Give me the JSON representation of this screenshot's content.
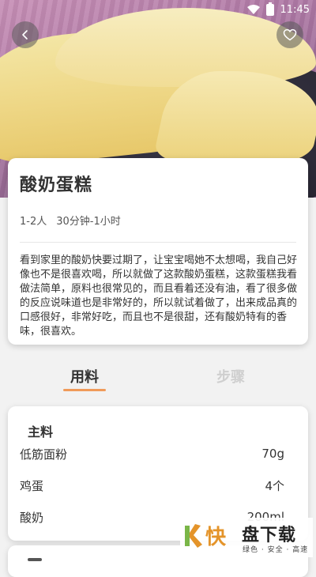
{
  "status_bar": {
    "time": "11:45",
    "wifi_icon": "wifi-icon",
    "battery_icon": "battery-icon"
  },
  "header": {
    "back_icon": "chevron-left-icon",
    "favorite_icon": "heart-icon"
  },
  "recipe": {
    "title": "酸奶蛋糕",
    "servings": "1-2人",
    "duration": "30分钟-1小时",
    "description": "看到家里的酸奶快要过期了，让宝宝喝她不太想喝，我自己好像也不是很喜欢喝，所以就做了这款酸奶蛋糕，这款蛋糕我看做法简单，原料也很常见的，而且看着还没有油，看了很多做的反应说味道也是非常好的，所以就试着做了，出来成品真的口感很好，非常好吃，而且也不是很甜，还有酸奶特有的香味，很喜欢。"
  },
  "tabs": [
    {
      "label": "用料",
      "active": true
    },
    {
      "label": "步骤",
      "active": false
    }
  ],
  "ingredients": {
    "section_title": "主料",
    "items": [
      {
        "name": "低筋面粉",
        "amount": "70g"
      },
      {
        "name": "鸡蛋",
        "amount": "4个"
      },
      {
        "name": "酸奶",
        "amount": "200ml"
      }
    ]
  },
  "watermark": {
    "brand_char": "快",
    "brand_text": "盘下载",
    "tagline": "绿色 · 安全 · 高速"
  },
  "colors": {
    "tab_underline": "#f09b5a",
    "inactive_tab": "#cfcfcf",
    "watermark_accent": "#e4942a"
  }
}
